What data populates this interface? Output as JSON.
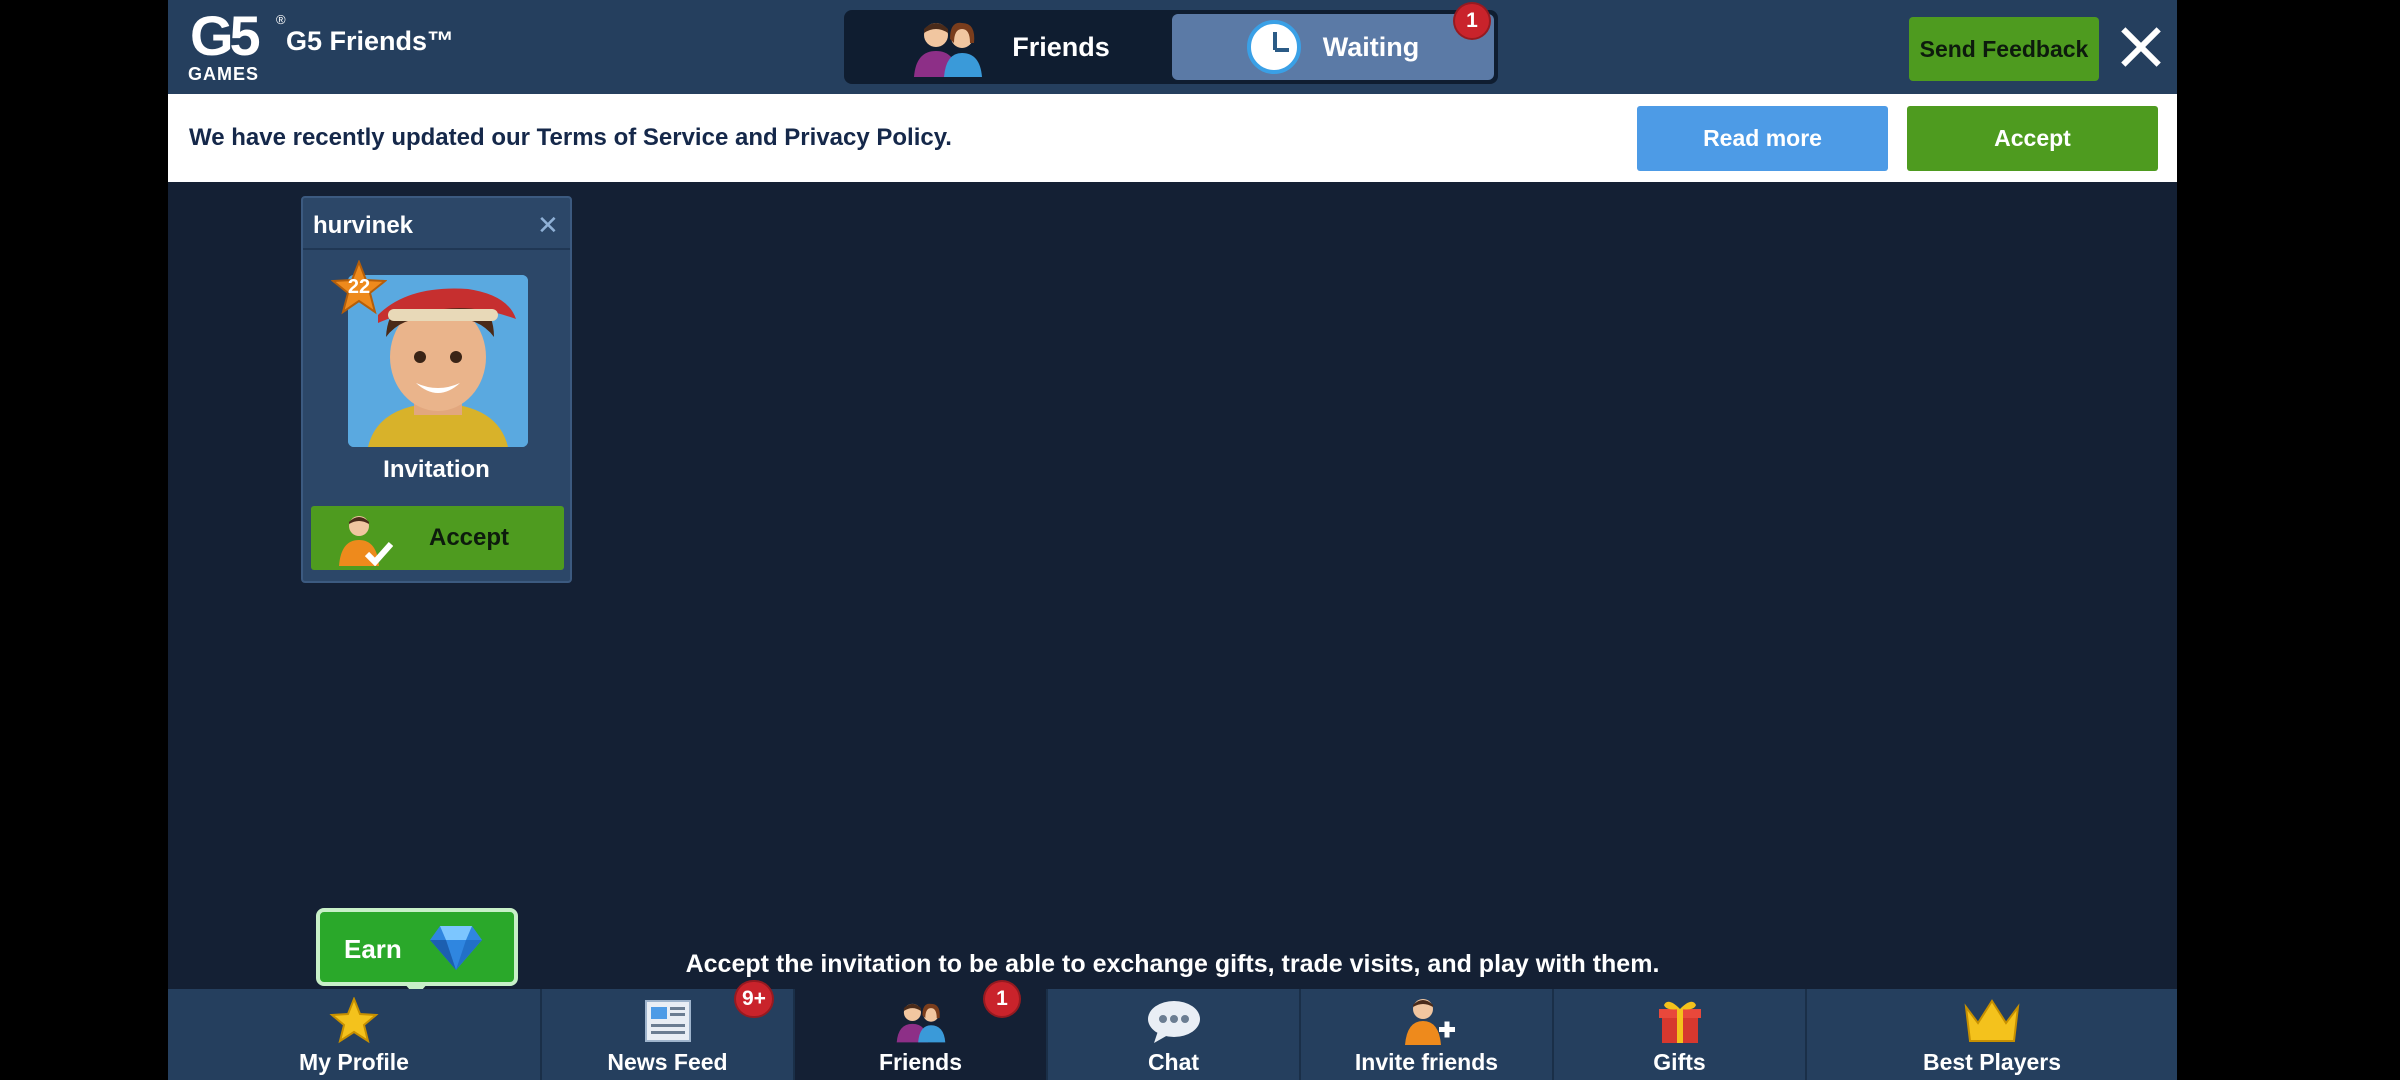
{
  "header": {
    "logo_main": "G5",
    "logo_sub": "GAMES",
    "logo_reg": "®",
    "app_title": "G5 Friends™",
    "tabs": [
      {
        "label": "Friends",
        "icon": "friends-icon",
        "active": false
      },
      {
        "label": "Waiting",
        "icon": "clock-icon",
        "active": true,
        "badge": "1"
      }
    ],
    "send_feedback_label": "Send Feedback"
  },
  "notice": {
    "text": "We have recently updated our Terms of Service and Privacy Policy.",
    "read_more_label": "Read more",
    "accept_label": "Accept"
  },
  "invite_card": {
    "name": "hurvinek",
    "level": "22",
    "status": "Invitation",
    "accept_label": "Accept"
  },
  "hint": "Accept the invitation to be able to exchange gifts, trade visits, and play with them.",
  "earn": {
    "label": "Earn",
    "icon": "gem-icon"
  },
  "bottom_nav": {
    "items": [
      {
        "label": "My Profile",
        "icon": "star-icon"
      },
      {
        "label": "News Feed",
        "icon": "newspaper-icon",
        "badge": "9+"
      },
      {
        "label": "Friends",
        "icon": "friends-icon",
        "badge": "1",
        "active": true
      },
      {
        "label": "Chat",
        "icon": "chat-bubbles-icon"
      },
      {
        "label": "Invite friends",
        "icon": "add-person-icon"
      },
      {
        "label": "Gifts",
        "icon": "gift-icon"
      },
      {
        "label": "Best Players",
        "icon": "crown-icon"
      }
    ]
  },
  "colors": {
    "header_bg": "#253f5e",
    "body_bg": "#142034",
    "green": "#4e9b1f",
    "blue": "#4d9be6",
    "badge_red": "#c9232b"
  }
}
